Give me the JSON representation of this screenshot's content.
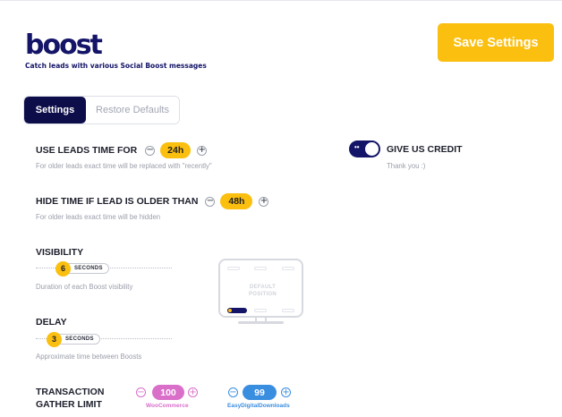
{
  "brand": {
    "logo_text": "boost",
    "tagline": "Catch leads with various Social Boost messages"
  },
  "header": {
    "save_label": "Save Settings"
  },
  "tabs": [
    {
      "label": "Settings",
      "active": true
    },
    {
      "label": "Restore Defaults",
      "active": false
    }
  ],
  "settings": {
    "leads_time": {
      "label": "USE LEADS TIME FOR",
      "value": "24h",
      "description": "For older leads exact time will be replaced with \"recently\""
    },
    "hide_time": {
      "label": "HIDE TIME IF LEAD IS OLDER THAN",
      "value": "48h",
      "description": "For older leads exact time will be hidden"
    },
    "visibility": {
      "label": "VISIBILITY",
      "value": "6",
      "unit": "SECONDS",
      "description": "Duration of each Boost visibility"
    },
    "delay": {
      "label": "DELAY",
      "value": "3",
      "unit": "SECONDS",
      "description": "Approximate time between Boosts"
    },
    "transaction_gather_limit": {
      "label_line1": "TRANSACTION",
      "label_line2": "GATHER LIMIT",
      "woocommerce": {
        "value": "100",
        "label": "WooCommerce",
        "color": "#d96fc9"
      },
      "edd": {
        "value": "99",
        "label": "EasyDigitalDownloads",
        "color": "#3a8ee0"
      }
    }
  },
  "credit": {
    "label": "GIVE US CREDIT",
    "description": "Thank you :)",
    "enabled": true
  },
  "position_preview": {
    "line1": "DEFAULT",
    "line2": "POSITION"
  },
  "icons": {
    "minus": "−",
    "plus": "+"
  },
  "colors": {
    "accent": "#fbbf10",
    "brand": "#141468"
  }
}
